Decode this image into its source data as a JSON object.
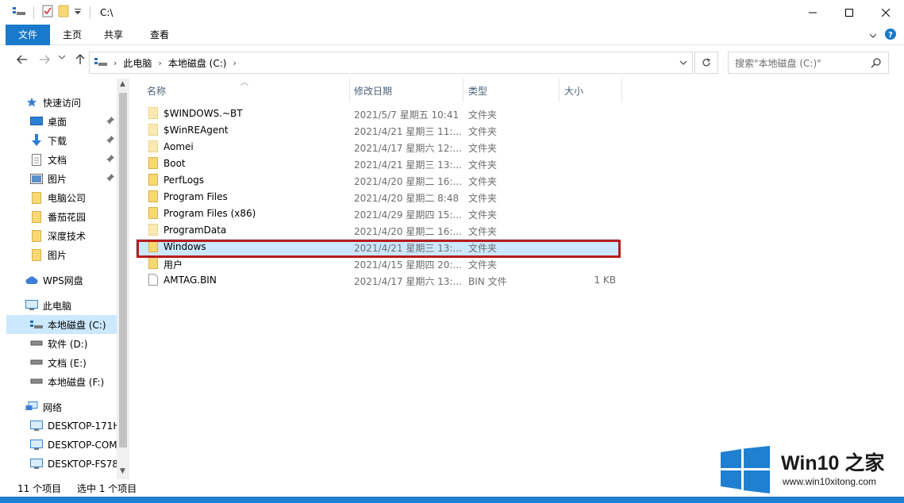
{
  "titlebar": {
    "path": "C:\\"
  },
  "ribbon": {
    "tabs": [
      "文件",
      "主页",
      "共享",
      "查看"
    ]
  },
  "address": {
    "crumbs": [
      "此电脑",
      "本地磁盘 (C:)"
    ]
  },
  "search": {
    "placeholder": "搜索\"本地磁盘 (C:)\""
  },
  "sidebar": {
    "quick_access": "快速访问",
    "quick_items": [
      "桌面",
      "下载",
      "文档",
      "图片",
      "电脑公司",
      "番茄花园",
      "深度技术",
      "图片"
    ],
    "wps": "WPS网盘",
    "this_pc": "此电脑",
    "drives": [
      "本地磁盘 (C:)",
      "软件 (D:)",
      "文档 (E:)",
      "本地磁盘 (F:)"
    ],
    "network": "网络",
    "network_items": [
      "DESKTOP-171H",
      "DESKTOP-COM",
      "DESKTOP-FS78"
    ]
  },
  "columns": {
    "name": "名称",
    "date": "修改日期",
    "type": "类型",
    "size": "大小"
  },
  "files": [
    {
      "name": "$WINDOWS.~BT",
      "date": "2021/5/7 星期五 10:41",
      "type": "文件夹",
      "size": "",
      "kind": "folder-ghost"
    },
    {
      "name": "$WinREAgent",
      "date": "2021/4/21 星期三 11:...",
      "type": "文件夹",
      "size": "",
      "kind": "folder-ghost"
    },
    {
      "name": "Aomei",
      "date": "2021/4/17 星期六 12:...",
      "type": "文件夹",
      "size": "",
      "kind": "folder-ghost"
    },
    {
      "name": "Boot",
      "date": "2021/4/21 星期三 13:...",
      "type": "文件夹",
      "size": "",
      "kind": "folder"
    },
    {
      "name": "PerfLogs",
      "date": "2021/4/20 星期二 16:...",
      "type": "文件夹",
      "size": "",
      "kind": "folder"
    },
    {
      "name": "Program Files",
      "date": "2021/4/20 星期二 8:48",
      "type": "文件夹",
      "size": "",
      "kind": "folder"
    },
    {
      "name": "Program Files (x86)",
      "date": "2021/4/29 星期四 15:...",
      "type": "文件夹",
      "size": "",
      "kind": "folder"
    },
    {
      "name": "ProgramData",
      "date": "2021/4/20 星期二 16:...",
      "type": "文件夹",
      "size": "",
      "kind": "folder-ghost"
    },
    {
      "name": "Windows",
      "date": "2021/4/21 星期三 13:...",
      "type": "文件夹",
      "size": "",
      "kind": "folder"
    },
    {
      "name": "用户",
      "date": "2021/4/15 星期四 20:...",
      "type": "文件夹",
      "size": "",
      "kind": "folder"
    },
    {
      "name": "AMTAG.BIN",
      "date": "2021/4/17 星期六 13:...",
      "type": "BIN 文件",
      "size": "1 KB",
      "kind": "file"
    }
  ],
  "status": {
    "count": "11 个项目",
    "selected": "选中 1 个项目"
  },
  "watermark": {
    "title": "Win10 之家",
    "url": "www.win10xitong.com"
  },
  "colors": {
    "accent": "#1979ca",
    "selection": "#cce8ff",
    "highlight_border": "#b51d1d",
    "folder": "#f8d775"
  }
}
